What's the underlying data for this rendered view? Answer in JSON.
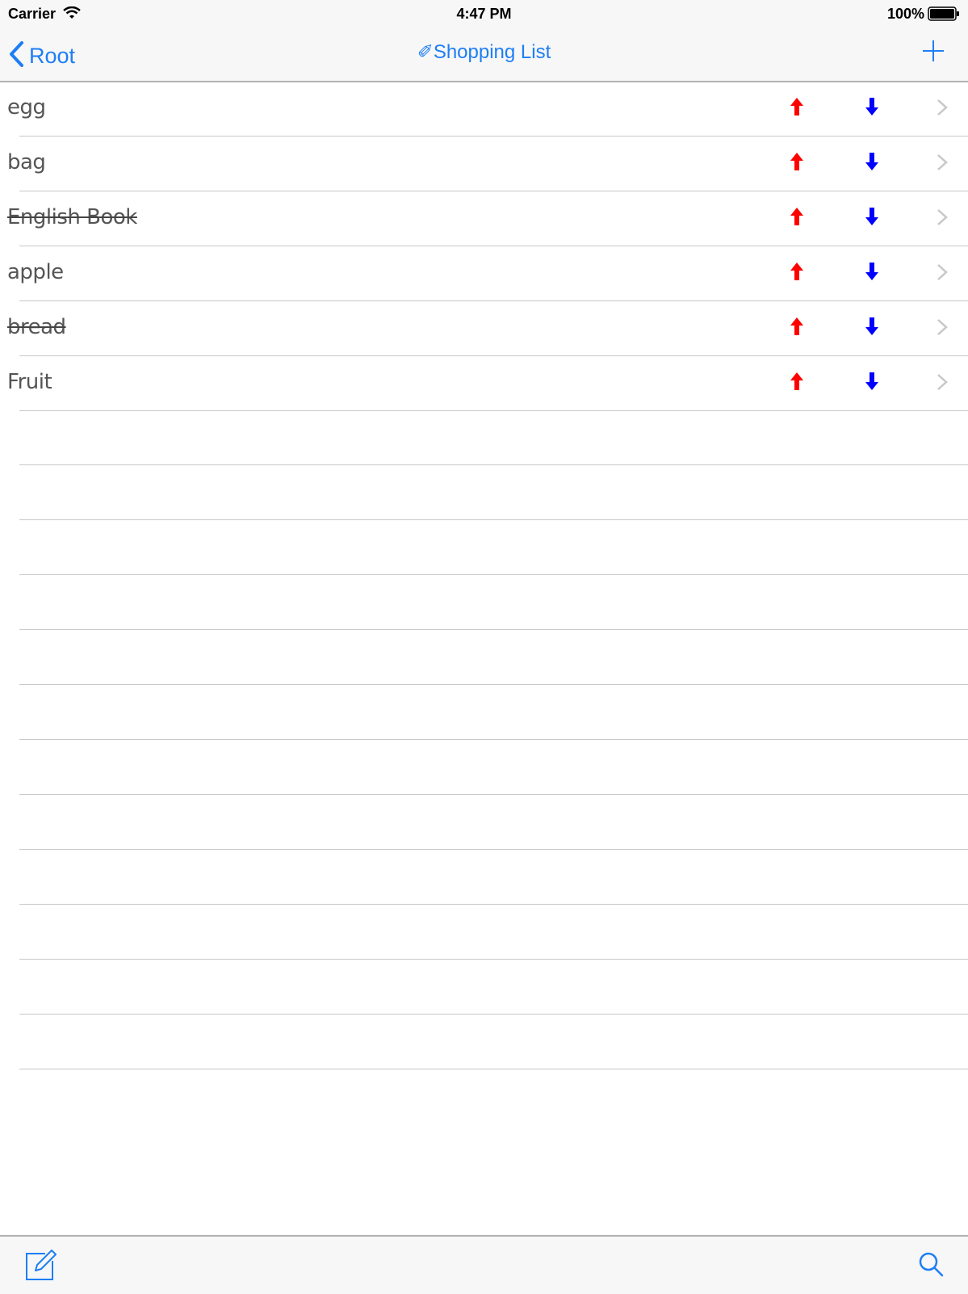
{
  "status_bar": {
    "carrier": "Carrier",
    "time": "4:47 PM",
    "battery": "100%"
  },
  "nav": {
    "back_label": "Root",
    "title": "✐Shopping List",
    "accent_color": "#1e7ef5"
  },
  "items": [
    {
      "label": "egg",
      "done": false
    },
    {
      "label": "bag",
      "done": false
    },
    {
      "label": "English Book",
      "done": true
    },
    {
      "label": "apple",
      "done": false
    },
    {
      "label": "bread",
      "done": true
    },
    {
      "label": "Fruit",
      "done": false
    }
  ],
  "icons": {
    "up": "up-arrow-icon",
    "down": "down-arrow-icon",
    "up_color": "#ff0000",
    "down_color": "#0000ff"
  },
  "toolbar": {
    "left_icon": "compose-icon",
    "right_icon": "search-icon"
  }
}
